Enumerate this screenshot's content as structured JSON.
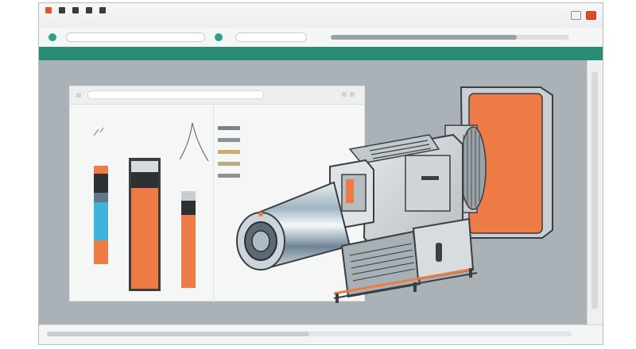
{
  "window": {
    "title": "",
    "accent": "#e0582a",
    "brand": "#2a8c74"
  },
  "toolbar": {
    "address_placeholder": "",
    "secondary_placeholder": "",
    "zoom_progress": 0.78
  },
  "ribbon": {
    "left_label": "",
    "mid_label": "",
    "right_label": ""
  },
  "panel": {
    "search_placeholder": "",
    "chart_colors": {
      "orange": "#ee7a45",
      "cyan": "#3fb3d9",
      "dark": "#2e3134",
      "bluegray": "#5f7889"
    },
    "legend_colors": [
      "#7c8186",
      "#8c9197",
      "#c9ad6a",
      "#b7a98a",
      "#8c9197"
    ]
  },
  "status": {
    "text": "",
    "progress": 0.5
  },
  "icons": {
    "app": "app-icon",
    "close": "close-icon",
    "minimize": "minimize-icon",
    "maximize": "maximize-icon"
  }
}
